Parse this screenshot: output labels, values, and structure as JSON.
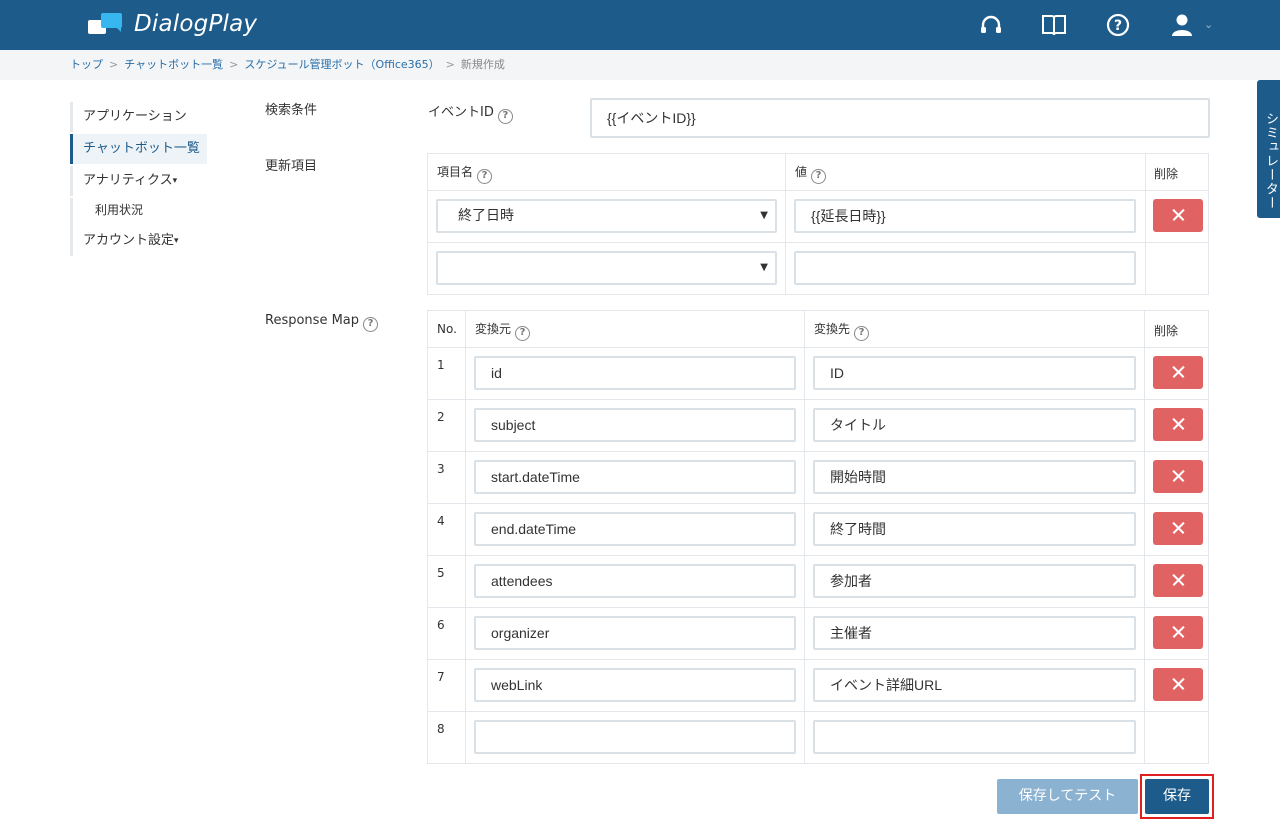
{
  "app": {
    "name": "DialogPlay"
  },
  "header_icons": [
    "headset-icon",
    "book-icon",
    "help-circle-icon",
    "user-icon"
  ],
  "breadcrumb": {
    "items": [
      "トップ",
      "チャットボット一覧",
      "スケジュール管理ボット（Office365）"
    ],
    "current": "新規作成",
    "separator": ">"
  },
  "sidebar": {
    "applications": "アプリケーション",
    "chatbot_list": "チャットボット一覧",
    "analytics": "アナリティクス",
    "usage": "利用状況",
    "account": "アカウント設定",
    "caret": "▾"
  },
  "simulator_tab": "シミュレーター",
  "search": {
    "label": "検索条件",
    "event_id_label": "イベントID",
    "event_id_value": "{{イベントID}}"
  },
  "update": {
    "label": "更新項目",
    "col_item": "項目名",
    "col_value": "値",
    "col_delete": "削除",
    "rows": [
      {
        "item": "終了日時",
        "value": "{{延長日時}}"
      },
      {
        "item": "",
        "value": ""
      }
    ]
  },
  "response_map": {
    "label": "Response Map",
    "col_no": "No.",
    "col_source": "変換元",
    "col_target": "変換先",
    "col_delete": "削除",
    "rows": [
      {
        "no": "1",
        "source": "id",
        "target": "ID"
      },
      {
        "no": "2",
        "source": "subject",
        "target": "タイトル"
      },
      {
        "no": "3",
        "source": "start.dateTime",
        "target": "開始時間"
      },
      {
        "no": "4",
        "source": "end.dateTime",
        "target": "終了時間"
      },
      {
        "no": "5",
        "source": "attendees",
        "target": "参加者"
      },
      {
        "no": "6",
        "source": "organizer",
        "target": "主催者"
      },
      {
        "no": "7",
        "source": "webLink",
        "target": "イベント詳細URL"
      },
      {
        "no": "8",
        "source": "",
        "target": ""
      }
    ]
  },
  "actions": {
    "save_and_test": "保存してテスト",
    "save": "保存"
  },
  "colors": {
    "primary": "#1d5b8a",
    "danger": "#e06263",
    "accent": "#37b6ef",
    "highlight": "#e02020"
  }
}
